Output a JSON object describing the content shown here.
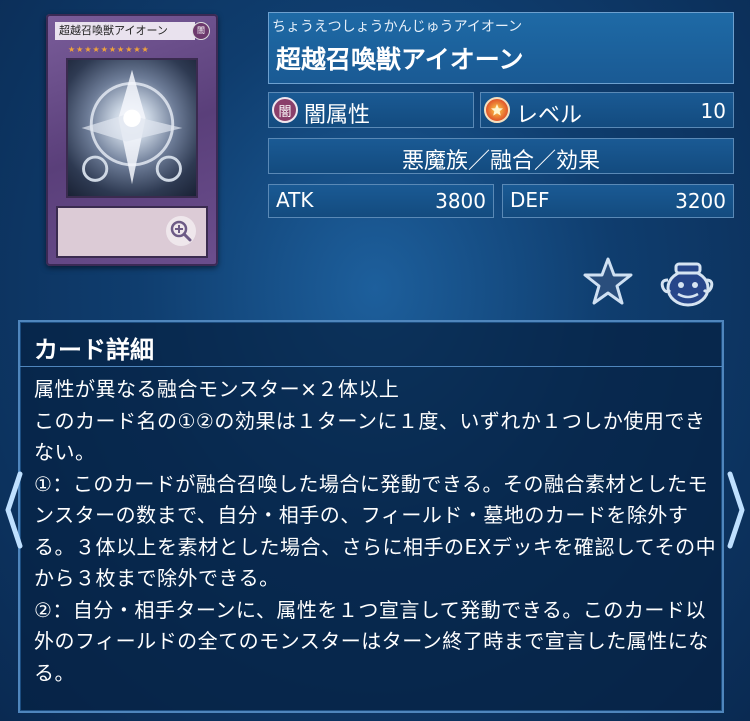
{
  "card": {
    "image_name": "超越召喚獣アイオーン",
    "image_attr": "闇"
  },
  "info": {
    "ruby": "ちょうえつしょうかんじゅうアイオーン",
    "title": "超越召喚獣アイオーン",
    "attribute_label": "闇属性",
    "attribute_icon_text": "闇",
    "level_label": "レベル",
    "level_value": "10",
    "type_line": "悪魔族／融合／効果",
    "atk_label": "ATK",
    "atk_value": "3800",
    "def_label": "DEF",
    "def_value": "3200"
  },
  "actions": {
    "favorite_icon": "star-icon",
    "deck_icon": "pot-icon"
  },
  "detail": {
    "header": "カード詳細",
    "text": "属性が異なる融合モンスター×２体以上\nこのカード名の①②の効果は１ターンに１度、いずれか１つしか使用できない。\n①：このカードが融合召喚した場合に発動できる。その融合素材としたモンスターの数まで、自分・相手の、フィールド・墓地のカードを除外する。３体以上を素材とした場合、さらに相手のEXデッキを確認してその中から３枚まで除外できる。\n②：自分・相手ターンに、属性を１つ宣言して発動できる。このカード以外のフィールドの全てのモンスターはターン終了時まで宣言した属性になる。"
  },
  "colors": {
    "background": "#0f3d6e",
    "accent": "#4f86bd",
    "level_icon": "#e0552a",
    "dark_attribute": "#8a3f6b"
  }
}
